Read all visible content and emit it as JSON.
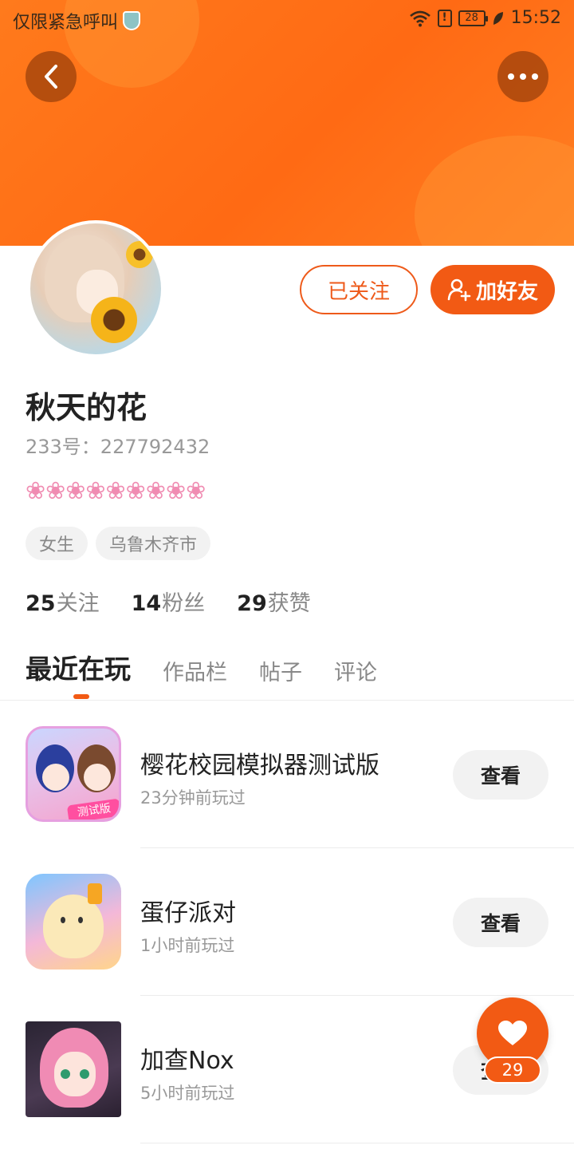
{
  "status_bar": {
    "carrier_text": "仅限紧急呼叫",
    "battery": "28",
    "time": "15:52",
    "alert": "!"
  },
  "profile": {
    "name": "秋天的花",
    "id_text": "233号：227792432",
    "signature": "❀❀❀❀❀❀❀❀❀",
    "follow_label": "已关注",
    "add_friend_label": "加好友",
    "tags": [
      "女生",
      "乌鲁木齐市"
    ],
    "stats": [
      {
        "value": "25",
        "label": "关注"
      },
      {
        "value": "14",
        "label": "粉丝"
      },
      {
        "value": "29",
        "label": "获赞"
      }
    ]
  },
  "tabs": [
    "最近在玩",
    "作品栏",
    "帖子",
    "评论"
  ],
  "games": [
    {
      "title": "樱花校园模拟器测试版",
      "subtitle": "23分钟前玩过",
      "button": "查看",
      "badge": "测试版"
    },
    {
      "title": "蛋仔派对",
      "subtitle": "1小时前玩过",
      "button": "查看"
    },
    {
      "title": "加查Nox",
      "subtitle": "5小时前玩过",
      "button": "查看"
    }
  ],
  "like": {
    "count": "29"
  },
  "colors": {
    "accent": "#f25a14",
    "banner": "#ff7a1c",
    "muted_text": "#999999",
    "signature_pink": "#f08cb2"
  },
  "icons": {
    "back": "chevron-left-icon",
    "more": "more-dots-icon",
    "add_friend": "add-user-icon",
    "like": "heart-icon"
  }
}
